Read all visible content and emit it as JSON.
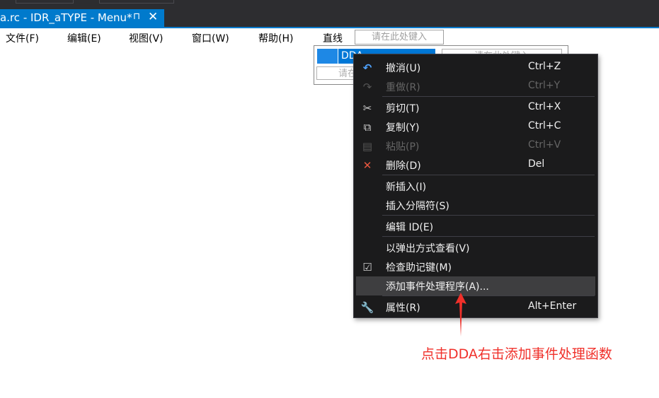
{
  "tab": {
    "title": "a.rc - IDR_aTYPE - Menu*",
    "pin": "⊓",
    "close": "✕"
  },
  "menubar": {
    "items": [
      "文件(F)",
      "编辑(E)",
      "视图(V)",
      "窗口(W)",
      "帮助(H)",
      "直线"
    ],
    "type_here": "请在此处键入"
  },
  "submenu": {
    "selected": "DDA",
    "type_here_below": "请在",
    "type_here_right": "请在此处键入"
  },
  "context_menu": {
    "items": [
      {
        "label": "撤消(U)",
        "shortcut": "Ctrl+Z",
        "icon": "undo-icon",
        "enabled": true
      },
      {
        "label": "重做(R)",
        "shortcut": "Ctrl+Y",
        "icon": "redo-icon",
        "enabled": false
      },
      {
        "label": "剪切(T)",
        "shortcut": "Ctrl+X",
        "icon": "scissors-icon",
        "enabled": true
      },
      {
        "label": "复制(Y)",
        "shortcut": "Ctrl+C",
        "icon": "copy-icon",
        "enabled": true
      },
      {
        "label": "粘贴(P)",
        "shortcut": "Ctrl+V",
        "icon": "paste-icon",
        "enabled": false
      },
      {
        "label": "删除(D)",
        "shortcut": "Del",
        "icon": "delete-icon",
        "enabled": true
      },
      {
        "label": "新插入(I)",
        "shortcut": "",
        "icon": "",
        "enabled": true
      },
      {
        "label": "插入分隔符(S)",
        "shortcut": "",
        "icon": "",
        "enabled": true
      },
      {
        "label": "编辑 ID(E)",
        "shortcut": "",
        "icon": "",
        "enabled": true
      },
      {
        "label": "以弹出方式查看(V)",
        "shortcut": "",
        "icon": "",
        "enabled": true
      },
      {
        "label": "检查助记键(M)",
        "shortcut": "",
        "icon": "check-mnemonic-icon",
        "enabled": true
      },
      {
        "label": "添加事件处理程序(A)...",
        "shortcut": "",
        "icon": "",
        "enabled": true,
        "highlighted": true
      },
      {
        "label": "属性(R)",
        "shortcut": "Alt+Enter",
        "icon": "wrench-icon",
        "enabled": true
      }
    ]
  },
  "annotation": {
    "text": "点击DDA右击添加事件处理函数",
    "color": "#f0302a"
  },
  "colors": {
    "accent": "#007acc",
    "menu_bg": "#1b1b1c",
    "highlight": "#3e3e40"
  }
}
